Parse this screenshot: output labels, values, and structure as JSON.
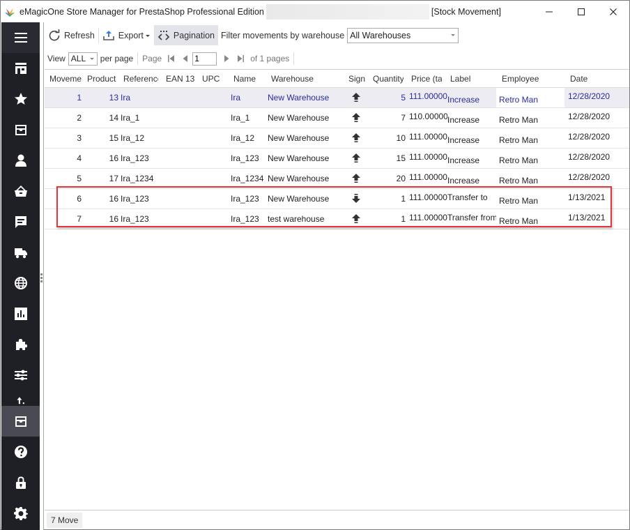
{
  "window": {
    "app_title": "eMagicOne Store Manager for PrestaShop Professional Edition",
    "section_title": "[Stock Movement]",
    "controls": {
      "minimize": "—",
      "maximize": "☐",
      "close": "✕"
    }
  },
  "sidebar": {
    "items": [
      {
        "name": "menu",
        "icon": "hamburger-icon"
      },
      {
        "name": "store",
        "icon": "store-icon"
      },
      {
        "name": "favorites",
        "icon": "star-icon"
      },
      {
        "name": "catalog",
        "icon": "inbox-icon"
      },
      {
        "name": "customers",
        "icon": "user-icon"
      },
      {
        "name": "orders",
        "icon": "basket-icon"
      },
      {
        "name": "messages",
        "icon": "chat-icon"
      },
      {
        "name": "shipping",
        "icon": "truck-icon"
      },
      {
        "name": "localization",
        "icon": "globe-icon"
      },
      {
        "name": "reports",
        "icon": "bar-chart-icon"
      },
      {
        "name": "addons",
        "icon": "puzzle-icon"
      },
      {
        "name": "settings-sliders",
        "icon": "sliders-icon"
      },
      {
        "name": "import-export",
        "icon": "upload-icon"
      },
      {
        "name": "stock",
        "icon": "inbox-icon",
        "active": true
      },
      {
        "name": "help",
        "icon": "help-icon"
      },
      {
        "name": "security",
        "icon": "lock-icon"
      },
      {
        "name": "settings",
        "icon": "gear-icon"
      }
    ]
  },
  "toolbar": {
    "refresh_label": "Refresh",
    "export_label": "Export",
    "pagination_label": "Pagination",
    "filter_label": "Filter movements by warehouse",
    "warehouse_value": "All Warehouses"
  },
  "pager": {
    "view_label": "View",
    "view_value": "ALL",
    "per_page_label": "per page",
    "page_label": "Page",
    "page_value": "1",
    "of_pages_label": "of 1 pages"
  },
  "grid": {
    "columns": [
      "Moveme",
      "Product",
      "Reference",
      "EAN 13",
      "UPC",
      "Name",
      "Warehouse",
      "Sign",
      "Quantity",
      "Price (tax",
      "Label",
      "Employee",
      "Date"
    ],
    "rows": [
      {
        "movement": "1",
        "product": "13",
        "reference": "Ira",
        "ean13": "",
        "upc": "",
        "name": "Ira",
        "warehouse": "New Warehouse",
        "sign": "up",
        "quantity": "5",
        "price": "111.00000",
        "label": "Increase",
        "employee": "Retro Man",
        "date": "12/28/2020",
        "selected": true
      },
      {
        "movement": "2",
        "product": "14",
        "reference": "Ira_1",
        "ean13": "",
        "upc": "",
        "name": "Ira_1",
        "warehouse": "New Warehouse",
        "sign": "up",
        "quantity": "7",
        "price": "110.00000",
        "label": "Increase",
        "employee": "Retro Man",
        "date": "12/28/2020"
      },
      {
        "movement": "3",
        "product": "15",
        "reference": "Ira_12",
        "ean13": "",
        "upc": "",
        "name": "Ira_12",
        "warehouse": "New Warehouse",
        "sign": "up",
        "quantity": "10",
        "price": "111.00000",
        "label": "Increase",
        "employee": "Retro Man",
        "date": "12/28/2020"
      },
      {
        "movement": "4",
        "product": "16",
        "reference": "Ira_123",
        "ean13": "",
        "upc": "",
        "name": "Ira_123",
        "warehouse": "New Warehouse",
        "sign": "up",
        "quantity": "15",
        "price": "111.00000",
        "label": "Increase",
        "employee": "Retro Man",
        "date": "12/28/2020"
      },
      {
        "movement": "5",
        "product": "17",
        "reference": "Ira_1234",
        "ean13": "",
        "upc": "",
        "name": "Ira_1234",
        "warehouse": "New Warehouse",
        "sign": "up",
        "quantity": "20",
        "price": "111.00000",
        "label": "Increase",
        "employee": "Retro Man",
        "date": "12/28/2020"
      },
      {
        "movement": "6",
        "product": "16",
        "reference": "Ira_123",
        "ean13": "",
        "upc": "",
        "name": "Ira_123",
        "warehouse": "New Warehouse",
        "sign": "down",
        "quantity": "1",
        "price": "111.00000",
        "label": "Transfer to",
        "employee": "Retro Man",
        "date": "1/13/2021"
      },
      {
        "movement": "7",
        "product": "16",
        "reference": "Ira_123",
        "ean13": "",
        "upc": "",
        "name": "Ira_123",
        "warehouse": "test warehouse",
        "sign": "up",
        "quantity": "1",
        "price": "111.00000",
        "label": "Transfer from",
        "employee": "Retro Man",
        "date": "1/13/2021"
      }
    ]
  },
  "footer": {
    "count_label": "7 Move"
  },
  "colors": {
    "sidebar_bg": "#1f1f26",
    "sidebar_active": "#4a4a55",
    "selected_text": "#2b2b9e",
    "highlight_border": "#e2363b"
  }
}
